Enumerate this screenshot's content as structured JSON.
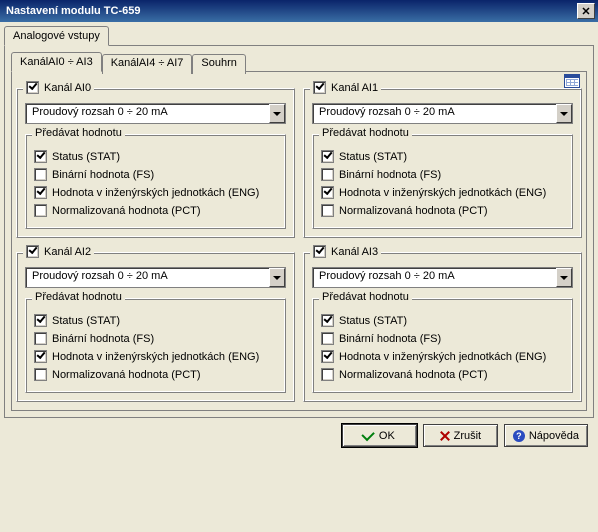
{
  "window": {
    "title": "Nastavení modulu TC-659"
  },
  "outerTabs": {
    "t0": "Analogové vstupy"
  },
  "innerTabs": {
    "t0": "KanálAI0 ÷ AI3",
    "t1": "KanálAI4 ÷ AI7",
    "t2": "Souhrn"
  },
  "groupInnerTitle": "Předávat hodnotu",
  "rangeValue": "Proudový rozsah     0 ÷ 20 mA",
  "opts": {
    "stat": "Status (STAT)",
    "fs": "Binární hodnota (FS)",
    "eng": "Hodnota v inženýrských jednotkách (ENG)",
    "pct": "Normalizovaná hodnota (PCT)"
  },
  "channels": {
    "c0": {
      "title": "Kanál AI0"
    },
    "c1": {
      "title": "Kanál AI1"
    },
    "c2": {
      "title": "Kanál AI2"
    },
    "c3": {
      "title": "Kanál AI3"
    }
  },
  "buttons": {
    "ok": "OK",
    "cancel": "Zrušit",
    "help": "Nápověda"
  }
}
